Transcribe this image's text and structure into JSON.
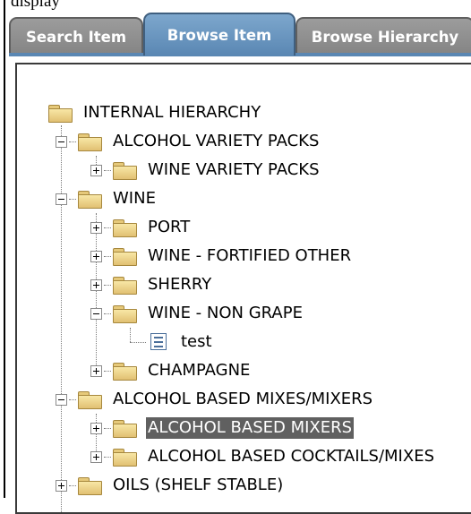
{
  "header": {
    "text": "display"
  },
  "tabs": [
    {
      "label": "Search Item",
      "active": false
    },
    {
      "label": "Browse Item",
      "active": true
    },
    {
      "label": "Browse Hierarchy",
      "active": false
    }
  ],
  "tree": {
    "root": {
      "label": "INTERNAL HIERARCHY",
      "icon": "folder-icon"
    },
    "nodes": [
      {
        "label": "ALCOHOL VARIETY PACKS",
        "level": 1,
        "expander": "minus",
        "icon": "folder-icon"
      },
      {
        "label": "WINE VARIETY PACKS",
        "level": 2,
        "expander": "plus",
        "icon": "folder-icon"
      },
      {
        "label": "WINE",
        "level": 1,
        "expander": "minus",
        "icon": "folder-icon"
      },
      {
        "label": "PORT",
        "level": 2,
        "expander": "plus",
        "icon": "folder-icon"
      },
      {
        "label": "WINE - FORTIFIED OTHER",
        "level": 2,
        "expander": "plus",
        "icon": "folder-icon"
      },
      {
        "label": "SHERRY",
        "level": 2,
        "expander": "plus",
        "icon": "folder-icon"
      },
      {
        "label": "WINE - NON GRAPE",
        "level": 2,
        "expander": "minus",
        "icon": "folder-icon"
      },
      {
        "label": "test",
        "level": 3,
        "expander": "none",
        "icon": "document-icon"
      },
      {
        "label": "CHAMPAGNE",
        "level": 2,
        "expander": "plus",
        "icon": "folder-icon"
      },
      {
        "label": "ALCOHOL BASED MIXES/MIXERS",
        "level": 1,
        "expander": "minus",
        "icon": "folder-icon"
      },
      {
        "label": "ALCOHOL BASED MIXERS",
        "level": 2,
        "expander": "plus",
        "icon": "folder-icon",
        "selected": true
      },
      {
        "label": "ALCOHOL BASED COCKTAILS/MIXES",
        "level": 2,
        "expander": "plus",
        "icon": "folder-icon"
      },
      {
        "label": "OILS (SHELF STABLE)",
        "level": 1,
        "expander": "plus",
        "icon": "folder-icon"
      }
    ]
  },
  "colors": {
    "active_tab": "#5a87b3",
    "inactive_tab": "#8f8f8f",
    "selection": "#606060",
    "folder": "#f0d488"
  }
}
